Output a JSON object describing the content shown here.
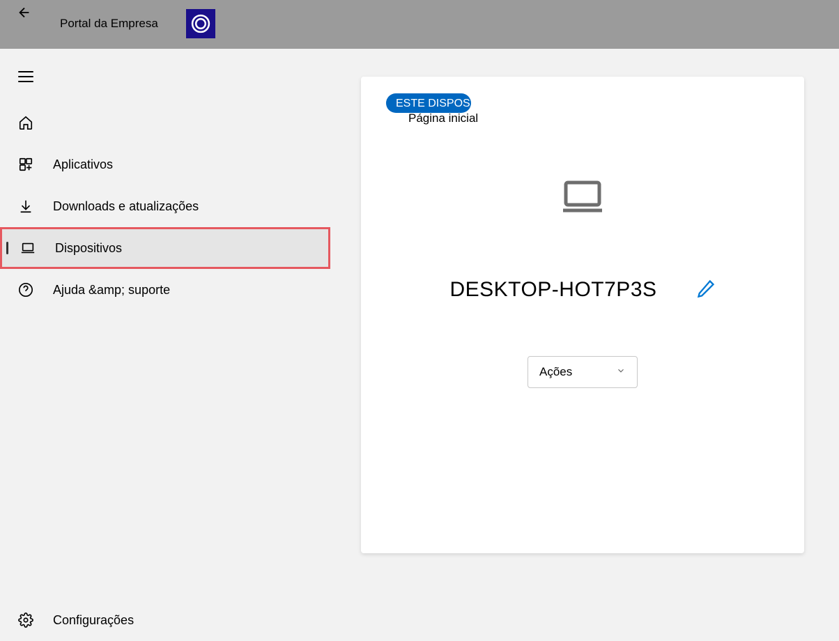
{
  "header": {
    "title": "Portal da Empresa"
  },
  "sidebar": {
    "items": [
      {
        "label": ""
      },
      {
        "label": "Aplicativos"
      },
      {
        "label": "Downloads e atualizações"
      },
      {
        "label": "Dispositivos"
      },
      {
        "label": "Ajuda &amp; suporte"
      }
    ],
    "settings_label": "Configurações"
  },
  "main": {
    "badge": "ESTE DISPOSIT",
    "breadcrumb": "Página inicial",
    "device_name": "DESKTOP-HOT7P3S",
    "actions_label": "Ações"
  }
}
